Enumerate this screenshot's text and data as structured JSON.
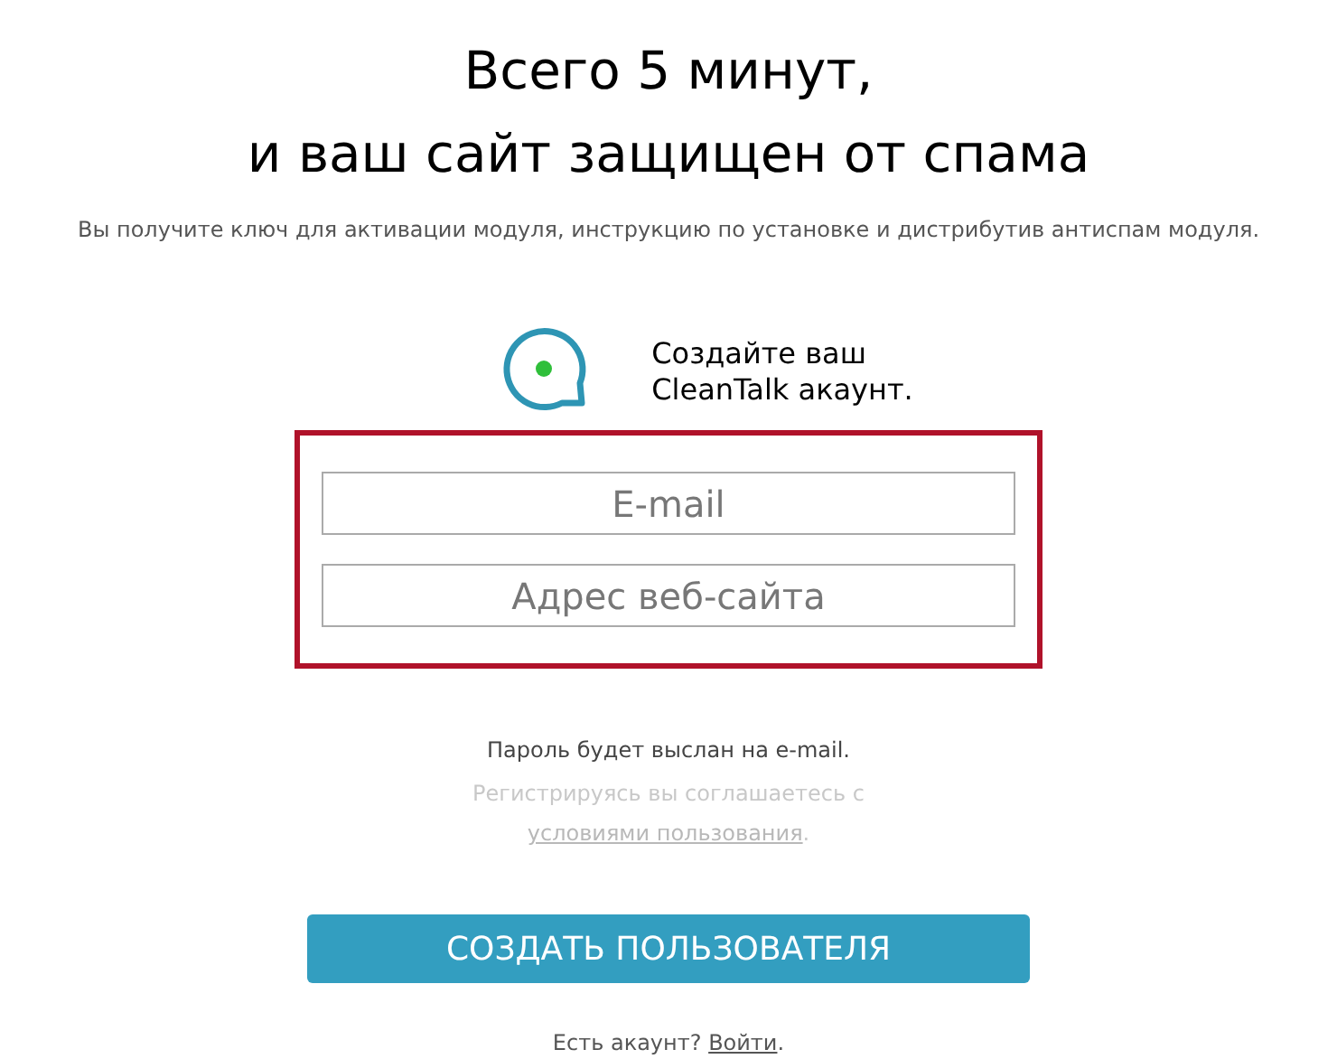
{
  "headline": [
    "Всего 5 минут,",
    "и ваш сайт защищен от спама"
  ],
  "subtitle": "Вы получите ключ для активации модуля, инструкцию по установке и дистрибутив антиспам модуля.",
  "brand": {
    "caption": [
      "Создайте ваш",
      "CleanTalk акаунт."
    ]
  },
  "fields": [
    {
      "placeholder": "E-mail"
    },
    {
      "placeholder": "Адрес веб-сайта"
    }
  ],
  "password_note": "Пароль будет выслан на e-mail.",
  "terms": {
    "before": "Регистрируясь вы соглашаетесь с ",
    "link": "условиями пользования",
    "after": "."
  },
  "submit": "СОЗДАТЬ ПОЛЬЗОВАТЕЛЯ",
  "login": {
    "before": "Есть акаунт? ",
    "link": "Войти",
    "after": "."
  }
}
